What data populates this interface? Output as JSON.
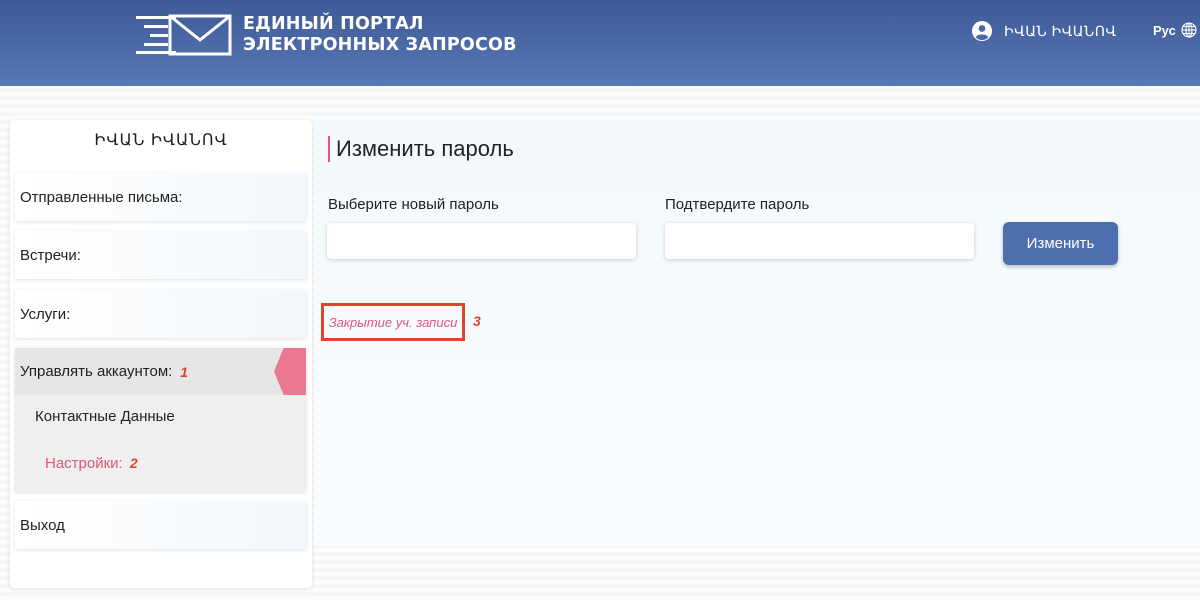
{
  "header": {
    "title_line1": "ЕДИНЫЙ ПОРТАЛ",
    "title_line2": "ЭЛЕКТРОННЫХ ЗАПРОСОВ",
    "user_name": "ԻՎԱՆ ԻՎԱՆՈՎ",
    "language": "Рус",
    "icons": [
      "envelope-logo-icon",
      "user-circle-icon",
      "globe-icon"
    ],
    "colors": {
      "bar_top": "#3e5a97",
      "bar_bottom": "#5877b5"
    }
  },
  "sidebar": {
    "user_name": "ԻՎԱՆ ԻՎԱՆՈՎ",
    "items": [
      {
        "label": "Отправленные письма:"
      },
      {
        "label": "Встречи:"
      },
      {
        "label": "Услуги:"
      },
      {
        "label": "Управлять аккаунтом:",
        "annotation": "1"
      },
      {
        "label": "Выход"
      }
    ],
    "sub_items": [
      {
        "label": "Контактные Данные"
      },
      {
        "label": "Настройки:",
        "annotation": "2"
      }
    ],
    "active_color": "#ec7791"
  },
  "main": {
    "title": "Изменить пароль",
    "new_password_label": "Выберите новый пароль",
    "new_password_value": "",
    "confirm_password_label": "Подтвердите пароль",
    "confirm_password_value": "",
    "submit_label": "Изменить",
    "close_account_link": "Закрытие уч. записи",
    "close_annotation": "3",
    "colors": {
      "accent": "#e0577a",
      "button": "#4e6fae",
      "annotation": "#e0452c"
    }
  }
}
